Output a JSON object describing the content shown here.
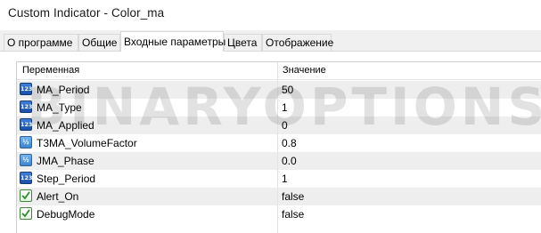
{
  "window": {
    "title": "Custom Indicator - Color_ma"
  },
  "tabs": [
    {
      "label": "О программе",
      "active": false
    },
    {
      "label": "Общие",
      "active": false
    },
    {
      "label": "Входные параметры",
      "active": true
    },
    {
      "label": "Цвета",
      "active": false
    },
    {
      "label": "Отображение",
      "active": false
    }
  ],
  "grid": {
    "columns": {
      "variable": "Переменная",
      "value": "Значение"
    },
    "rows": [
      {
        "name": "MA_Period",
        "value": "50",
        "type_icon": "int-icon",
        "icon_text": "123"
      },
      {
        "name": "MA_Type",
        "value": "1",
        "type_icon": "int-icon",
        "icon_text": "123"
      },
      {
        "name": "MA_Applied",
        "value": "0",
        "type_icon": "int-icon",
        "icon_text": "123"
      },
      {
        "name": "T3MA_VolumeFactor",
        "value": "0.8",
        "type_icon": "double-icon",
        "icon_text": "½"
      },
      {
        "name": "JMA_Phase",
        "value": "0.0",
        "type_icon": "double-icon",
        "icon_text": "½"
      },
      {
        "name": "Step_Period",
        "value": "1",
        "type_icon": "int-icon",
        "icon_text": "123"
      },
      {
        "name": "Alert_On",
        "value": "false",
        "type_icon": "bool-icon",
        "icon_text": ""
      },
      {
        "name": "DebugMode",
        "value": "false",
        "type_icon": "bool-icon",
        "icon_text": ""
      }
    ]
  },
  "watermark": {
    "text": "BINARYOPTIONSIGNALS.COM"
  },
  "colors": {
    "tab_background": "#f0f0f0",
    "row_alt": "#eeeeee",
    "int_icon": "#2a62b8",
    "double_icon": "#5aa0e2",
    "bool_icon_border": "#3a8a3a"
  }
}
